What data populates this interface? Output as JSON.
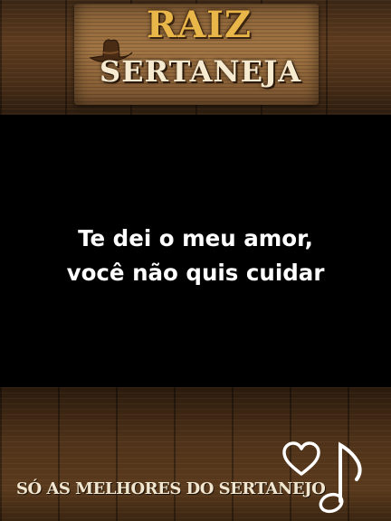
{
  "logo": {
    "line1": "RAIZ",
    "line2": "SERTANEJA",
    "hat_icon": "cowboy-hat-icon",
    "colors": {
      "line1": "#e9b64a",
      "line2": "#f6ead0"
    }
  },
  "lyrics": {
    "line1": "Te dei o meu amor,",
    "line2": "você não quis cuidar"
  },
  "footer": {
    "tagline": "SÓ AS MELHORES DO SERTANEJO",
    "heart_icon": "heart-outline-icon",
    "note_icon": "music-note-icon"
  },
  "colors": {
    "background": "#000000",
    "wood": "#5b3a1e",
    "lyrics_text": "#ffffff"
  }
}
